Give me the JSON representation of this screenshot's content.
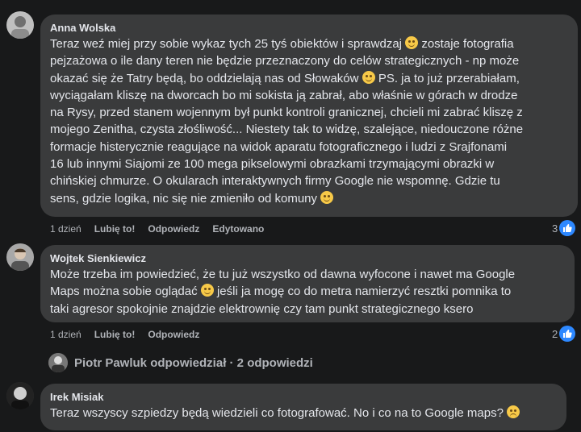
{
  "comments": [
    {
      "author": "Anna Wolska",
      "text_lines": [
        "Teraz weź miej przy sobie wykaz tych 25 tyś obiektów i sprawdzaj",
        "zostaje fotografia",
        "pejzażowa o ile dany teren nie będzie przeznaczony do celów strategicznych - np może",
        "okazać się że Tatry będą, bo oddzielają nas od Słowaków",
        "PS. ja to już przerabiałam,",
        "wyciągałam kliszę na dworcach bo mi sokista ją zabrał, abo właśnie w górach w drodze",
        "na Rysy, przed stanem wojennym był punkt kontroli granicznej, chcieli mi zabrać kliszę z",
        "mojego Zenitha, czysta złośliwość... Niestety tak to widzę, szalejące, niedouczone różne",
        "formacje histerycznie reagujące na widok aparatu fotograficznego i ludzi z Srajfonami",
        "16 lub innymi Siajomi ze 100 mega pikselowymi obrazkami trzymającymi obrazki w",
        "chińskiej chmurze. O okularach interaktywnych firmy Google nie wspomnę. Gdzie tu",
        "sens, gdzie logika, nic się nie zmieniło od komuny"
      ],
      "time": "1 dzień",
      "like_label": "Lubię to!",
      "reply_label": "Odpowiedz",
      "edited_label": "Edytowano",
      "reaction_count": "3"
    },
    {
      "author": "Wojtek Sienkiewicz",
      "text_lines": [
        "Może trzeba im powiedzieć, że tu już wszystko od dawna wyfocone i nawet ma Google",
        "Maps można sobie oglądać",
        "jeśli ja mogę co do metra namierzyć resztki pomnika to",
        "taki agresor spokojnie znajdzie elektrownię czy tam punkt strategicznego ksero"
      ],
      "time": "1 dzień",
      "like_label": "Lubię to!",
      "reply_label": "Odpowiedz",
      "reaction_count": "2"
    },
    {
      "author": "Irek Misiak",
      "text_lines": [
        "Teraz wszyscy szpiedzy będą wiedzieli co fotografować. No i co na to Google maps?"
      ]
    }
  ],
  "replies_summary": "Piotr Pawluk odpowiedział · 2 odpowiedzi",
  "colors": {
    "background": "#18191a",
    "bubble": "#3a3b3c",
    "like_blue": "#2d88ff"
  },
  "icons": [
    "avatar",
    "like-reaction-icon",
    "wink-emoji",
    "frown-emoji"
  ]
}
